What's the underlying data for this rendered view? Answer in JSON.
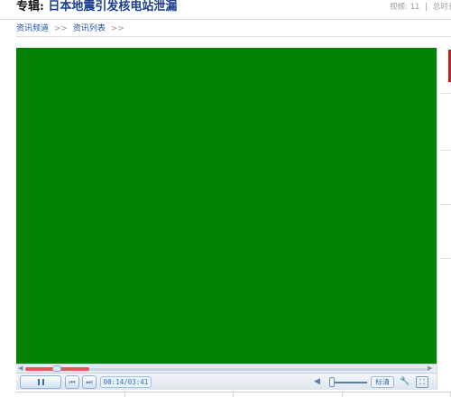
{
  "header": {
    "title_prefix": "专辑:",
    "title_topic": "日本地震引发核电站泄漏",
    "video_count_label": "视频:",
    "video_count": "11",
    "separator": "|",
    "total_label": "总时长"
  },
  "breadcrumb": {
    "items": [
      "资讯频道",
      "资讯列表"
    ],
    "separator": ">>"
  },
  "player": {
    "video_color": "#038203",
    "progress_loaded_fraction": 0.16,
    "time_display": "00:14/03:41",
    "quality_label": "标清",
    "volume_fraction": 0.05,
    "icons": {
      "play": "pause-icon",
      "prev": "prev-icon",
      "next": "next-icon",
      "volume": "speaker-icon",
      "settings": "wrench-icon",
      "fullscreen": "fullscreen-icon"
    }
  },
  "colors": {
    "title_topic": "#1a3d8f",
    "link": "#1f4f9e",
    "progress_loaded": "#e35a5a",
    "accent_red": "#c81e1e"
  }
}
